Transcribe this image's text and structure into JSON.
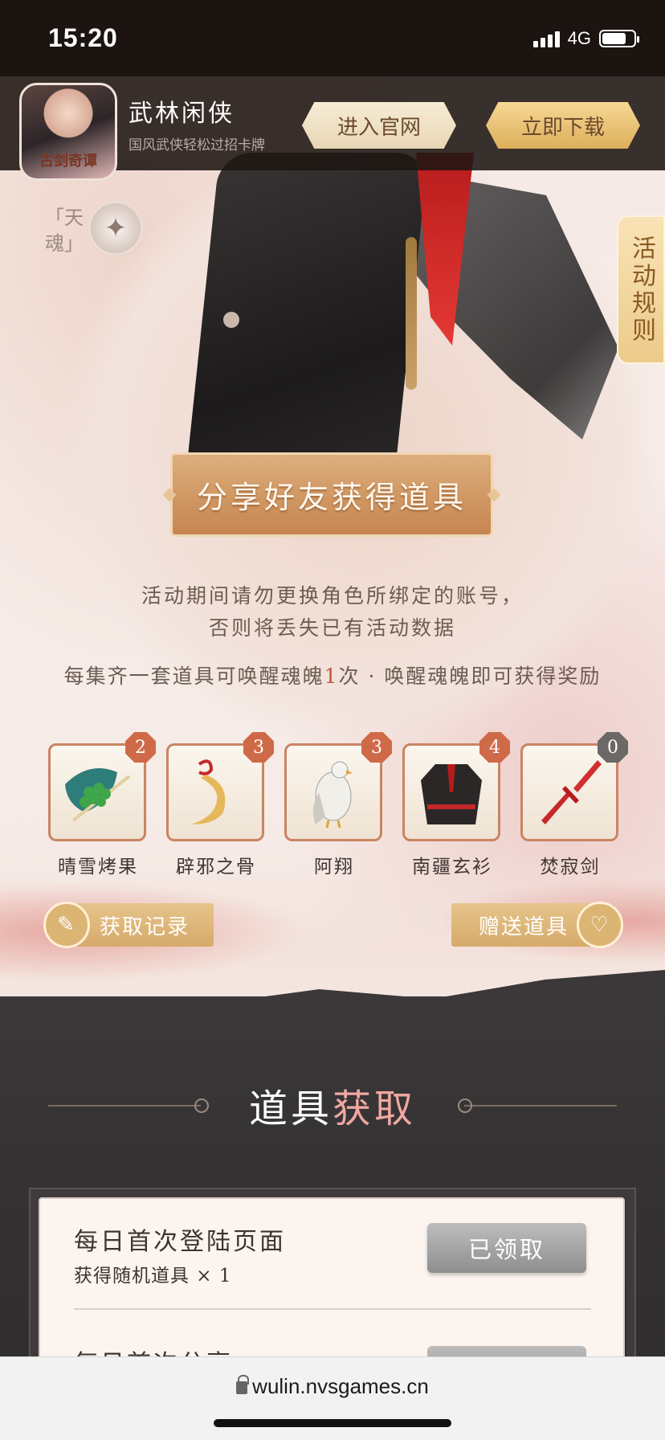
{
  "status_bar": {
    "time": "15:20",
    "network": "4G"
  },
  "app_banner": {
    "icon_text": "古剑奇谭",
    "name": "武林闲侠",
    "desc": "国风武侠轻松过招卡牌",
    "site_button": "进入官网",
    "download_button": "立即下载"
  },
  "side": {
    "deco_text": "「天魂」",
    "rules_tab": "活动规则"
  },
  "share": {
    "title": "分享好友获得道具"
  },
  "notice": {
    "line1": "活动期间请勿更换角色所绑定的账号，",
    "line2": "否则将丢失已有活动数据",
    "line3_pre": "每集齐一套道具可唤醒魂魄",
    "line3_hl": "1",
    "line3_post": "次 · 唤醒魂魄即可获得奖励"
  },
  "items": [
    {
      "name": "晴雪烤果",
      "count": "2",
      "icon": "fruit-skewer-icon"
    },
    {
      "name": "辟邪之骨",
      "count": "3",
      "icon": "horn-bone-icon"
    },
    {
      "name": "阿翔",
      "count": "3",
      "icon": "eagle-icon"
    },
    {
      "name": "南疆玄衫",
      "count": "4",
      "icon": "robe-icon"
    },
    {
      "name": "焚寂剑",
      "count": "0",
      "icon": "sword-icon"
    }
  ],
  "buttons": {
    "record": "获取记录",
    "gift": "赠送道具"
  },
  "section": {
    "title_a": "道具",
    "title_b": "获取"
  },
  "tasks": [
    {
      "title": "每日首次登陆页面",
      "desc": "获得随机道具 × 1",
      "button": "已领取"
    },
    {
      "title": "每日首次分享"
    }
  ],
  "browser": {
    "url": "wulin.nvsgames.cn"
  },
  "colors": {
    "accent_gold": "#d6aa6a",
    "badge": "#cf6a49",
    "dark_bg": "#3b3839"
  }
}
